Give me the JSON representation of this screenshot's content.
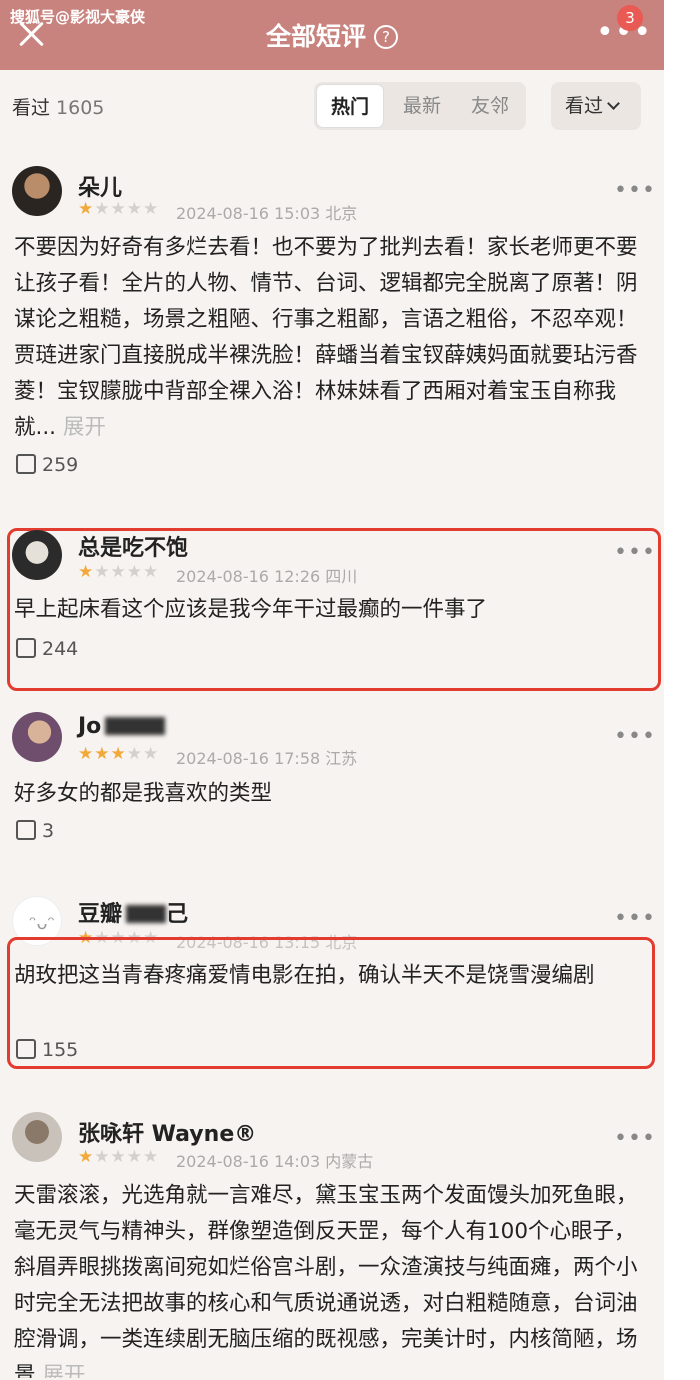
{
  "header": {
    "watermark": "搜狐号@影视大豪侠",
    "title": "全部短评",
    "help_icon": "question-circle-icon",
    "badge_count": "3"
  },
  "filter": {
    "seen_label": "看过",
    "seen_count": "1605",
    "tabs": [
      "热门",
      "最新",
      "友邻"
    ],
    "active_tab": "热门",
    "select_label": "看过"
  },
  "reviews": [
    {
      "user": "朵儿",
      "rating": 1,
      "meta": "2024-08-16 15:03 北京",
      "content": "不要因为好奇有多烂去看！也不要为了批判去看！家长老师更不要让孩子看！全片的人物、情节、台词、逻辑都完全脱离了原著！阴谋论之粗糙，场景之粗陋、行事之粗鄙，言语之粗俗，不忍卒观！贾琏进家门直接脱成半裸洗脸！薛蟠当着宝钗薛姨妈面就要玷污香菱！宝钗朦胧中背部全裸入浴！林妹妹看了西厢对着宝玉自称我就...",
      "expand": "展开",
      "likes": "259"
    },
    {
      "user": "总是吃不饱",
      "rating": 1,
      "meta": "2024-08-16 12:26 四川",
      "content": "早上起床看这个应该是我今年干过最癫的一件事了",
      "likes": "244"
    },
    {
      "user": "Jo",
      "rating": 3,
      "meta": "2024-08-16 17:58 江苏",
      "content": "好多女的都是我喜欢的类型",
      "likes": "3"
    },
    {
      "user": "豆瓣",
      "user_suffix": "己",
      "rating": 1,
      "meta": "2024-08-16 13:15 北京",
      "content": "胡玫把这当青春疼痛爱情电影在拍，确认半天不是饶雪漫编剧",
      "likes": "155"
    },
    {
      "user": "张咏轩 Wayne®",
      "rating": 1,
      "meta": "2024-08-16 14:03 内蒙古",
      "content": "天雷滚滚，光选角就一言难尽，黛玉宝玉两个发面馒头加死鱼眼，毫无灵气与精神头，群像塑造倒反天罡，每个人有100个心眼子，斜眉弄眼挑拨离间宛如烂俗宫斗剧，一众渣演技与纯面瘫，两个小时完全无法把故事的核心和气质说通说透，对白粗糙随意，台词油腔滑调，一类连续剧无脑压缩的既视感，完美计时，内核简陋，场景",
      "expand": "展开",
      "likes": ""
    }
  ],
  "colors": {
    "header_bg": "#c9837e",
    "star": "#f0a93a",
    "highlight_box": "#e23c30"
  }
}
